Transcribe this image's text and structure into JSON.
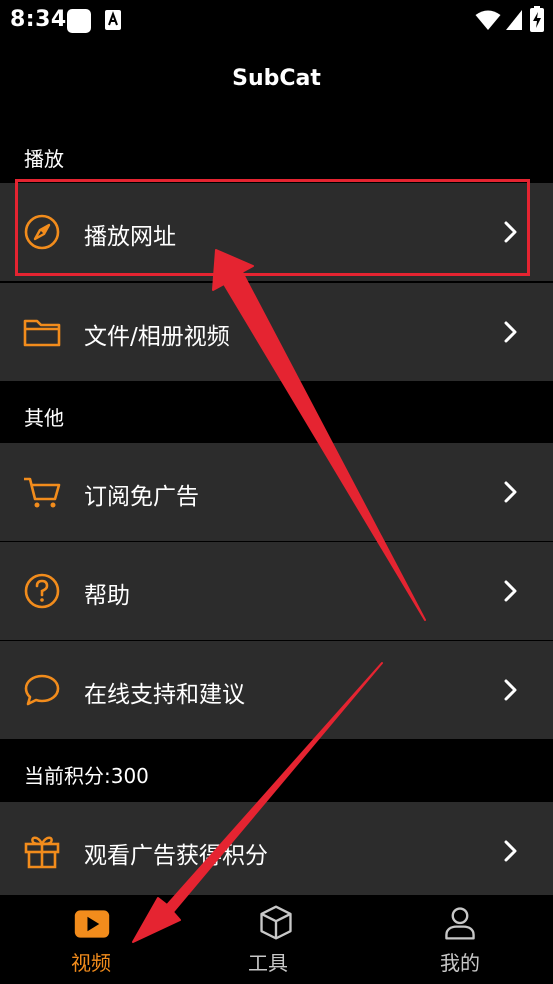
{
  "status_bar": {
    "time": "8:34"
  },
  "app": {
    "title": "SubCat"
  },
  "sections": {
    "play": {
      "header": "播放"
    },
    "other": {
      "header": "其他"
    },
    "points": {
      "header": "当前积分:300"
    }
  },
  "menu": {
    "play_url": {
      "label": "播放网址",
      "icon": "compass-icon"
    },
    "files_album": {
      "label": "文件/相册视频",
      "icon": "folder-icon"
    },
    "subscribe_no_ads": {
      "label": "订阅免广告",
      "icon": "cart-icon"
    },
    "help": {
      "label": "帮助",
      "icon": "question-icon"
    },
    "online_support": {
      "label": "在线支持和建议",
      "icon": "chat-bubble-icon"
    },
    "watch_ads_points": {
      "label": "观看广告获得积分",
      "icon": "gift-icon"
    }
  },
  "tabs": {
    "video": {
      "label": "视频",
      "icon": "play-icon",
      "active": true
    },
    "tools": {
      "label": "工具",
      "icon": "cube-icon"
    },
    "mine": {
      "label": "我的",
      "icon": "person-icon"
    }
  },
  "colors": {
    "accent": "#f28c1c",
    "background": "#000000",
    "row_background": "#2c2c2c",
    "annotation_red": "#e52431",
    "tab_inactive": "#c8c8c8"
  }
}
